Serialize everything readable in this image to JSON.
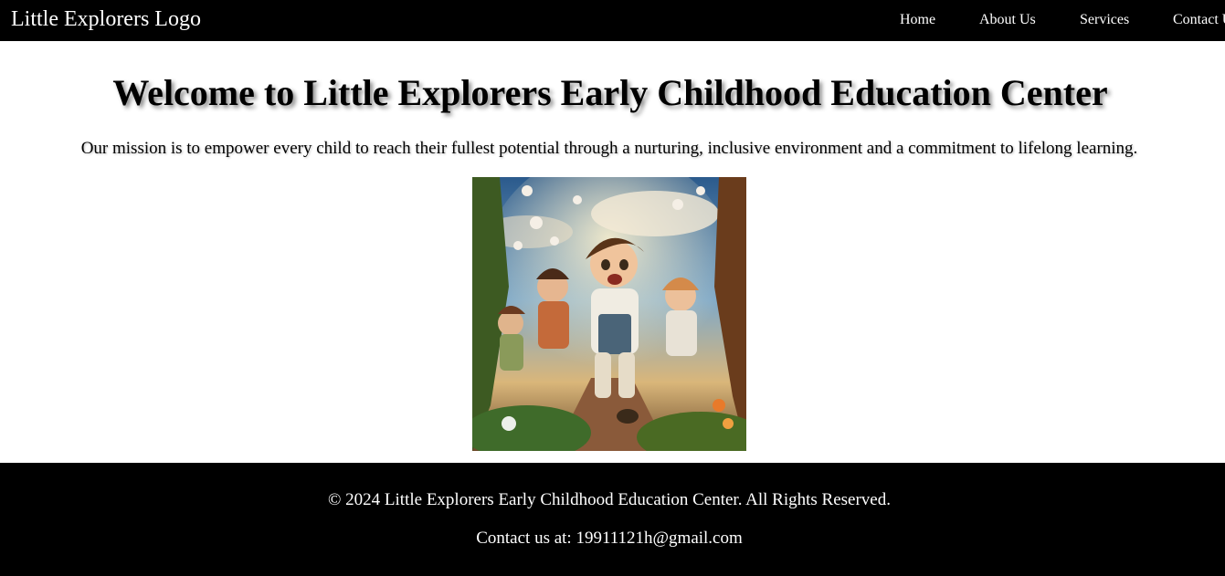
{
  "header": {
    "logo_text": "Little Explorers Logo",
    "nav": {
      "home": "Home",
      "about": "About Us",
      "services": "Services",
      "contact": "Contact Us"
    }
  },
  "main": {
    "title": "Welcome to Little Explorers Early Childhood Education Center",
    "mission": "Our mission is to empower every child to reach their fullest potential through a nurturing, inclusive environment and a commitment to lifelong learning."
  },
  "footer": {
    "copyright": "© 2024 Little Explorers Early Childhood Education Center. All Rights Reserved.",
    "contact_prefix": "Contact us at: ",
    "email": "19911121h@gmail.com"
  },
  "colors": {
    "header_bg": "#000000",
    "footer_bg": "#000000",
    "page_bg": "#ffffff"
  }
}
